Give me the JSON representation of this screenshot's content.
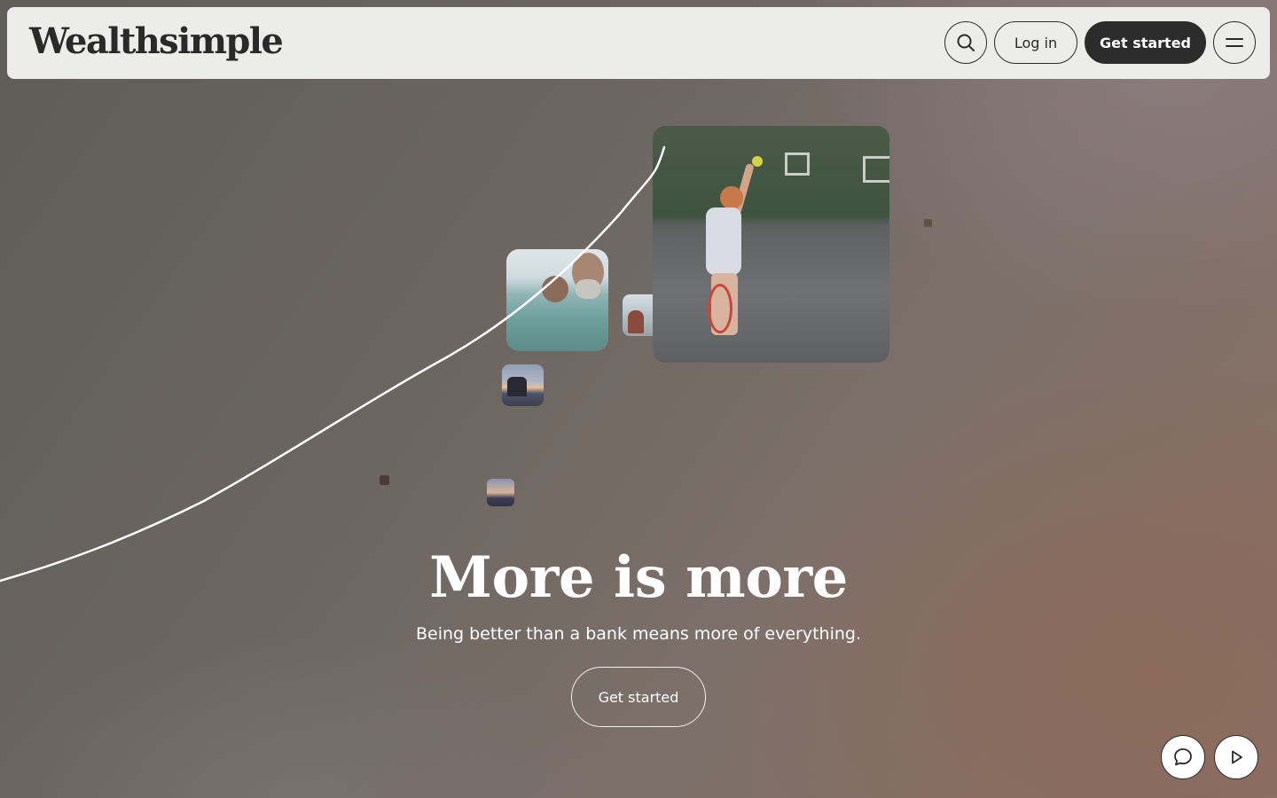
{
  "header": {
    "logo_text": "Wealthsimple",
    "search_icon": "search-icon",
    "login_label": "Log in",
    "get_started_label": "Get started",
    "menu_icon": "hamburger-menu-icon"
  },
  "hero": {
    "title": "More is more",
    "subtitle": "Being better than a bank means more of everything.",
    "cta_label": "Get started",
    "images": [
      {
        "name": "tennis-kid-photo"
      },
      {
        "name": "swimming-family-photo"
      },
      {
        "name": "sitting-person-photo"
      },
      {
        "name": "sunset-horse-photo"
      },
      {
        "name": "dusk-couple-photo"
      }
    ]
  },
  "floating": {
    "chat_icon": "chat-bubble-icon",
    "play_icon": "play-icon"
  },
  "colors": {
    "header_bg": "#ececeb",
    "primary_button": "#2c2c2c",
    "text_light": "#ffffff"
  }
}
